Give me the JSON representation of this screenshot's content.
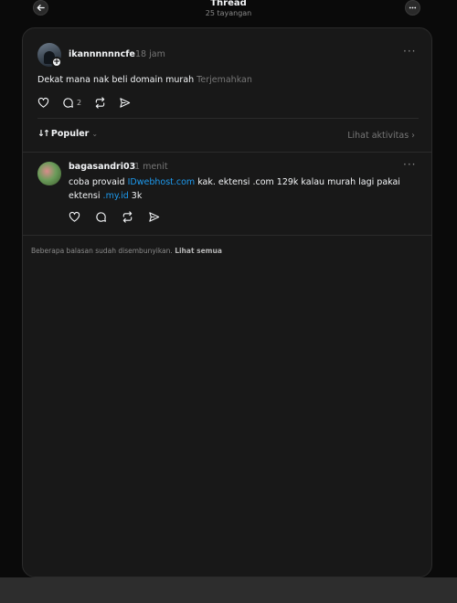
{
  "header": {
    "title": "Thread",
    "subtitle": "25 tayangan",
    "back_icon": "arrow-left-icon",
    "more_icon": "ellipsis-icon"
  },
  "post": {
    "username": "ikannnnnncfe",
    "time": "18 jam",
    "text": "Dekat mana nak beli domain murah",
    "translate": "Terjemahkan",
    "reply_count": "2"
  },
  "sort": {
    "label": "Populer",
    "arrows": "↓↑",
    "chevron": "⌄",
    "activity": "Lihat aktivitas ›"
  },
  "reply": {
    "username": "bagasandri03",
    "time": "1 menit",
    "text_before": "coba provaid ",
    "link1": "IDwebhost.com",
    "text_middle": " kak. ektensi .com 129k kalau murah lagi pakai ektensi ",
    "link2": ".my.id",
    "text_after": " 3k"
  },
  "hidden": {
    "note": "Beberapa balasan sudah disembunyikan.",
    "action": "Lihat semua"
  },
  "colors": {
    "background": "#0a0a0a",
    "card": "#181818",
    "link": "#1d9bf0",
    "muted": "#777777"
  }
}
